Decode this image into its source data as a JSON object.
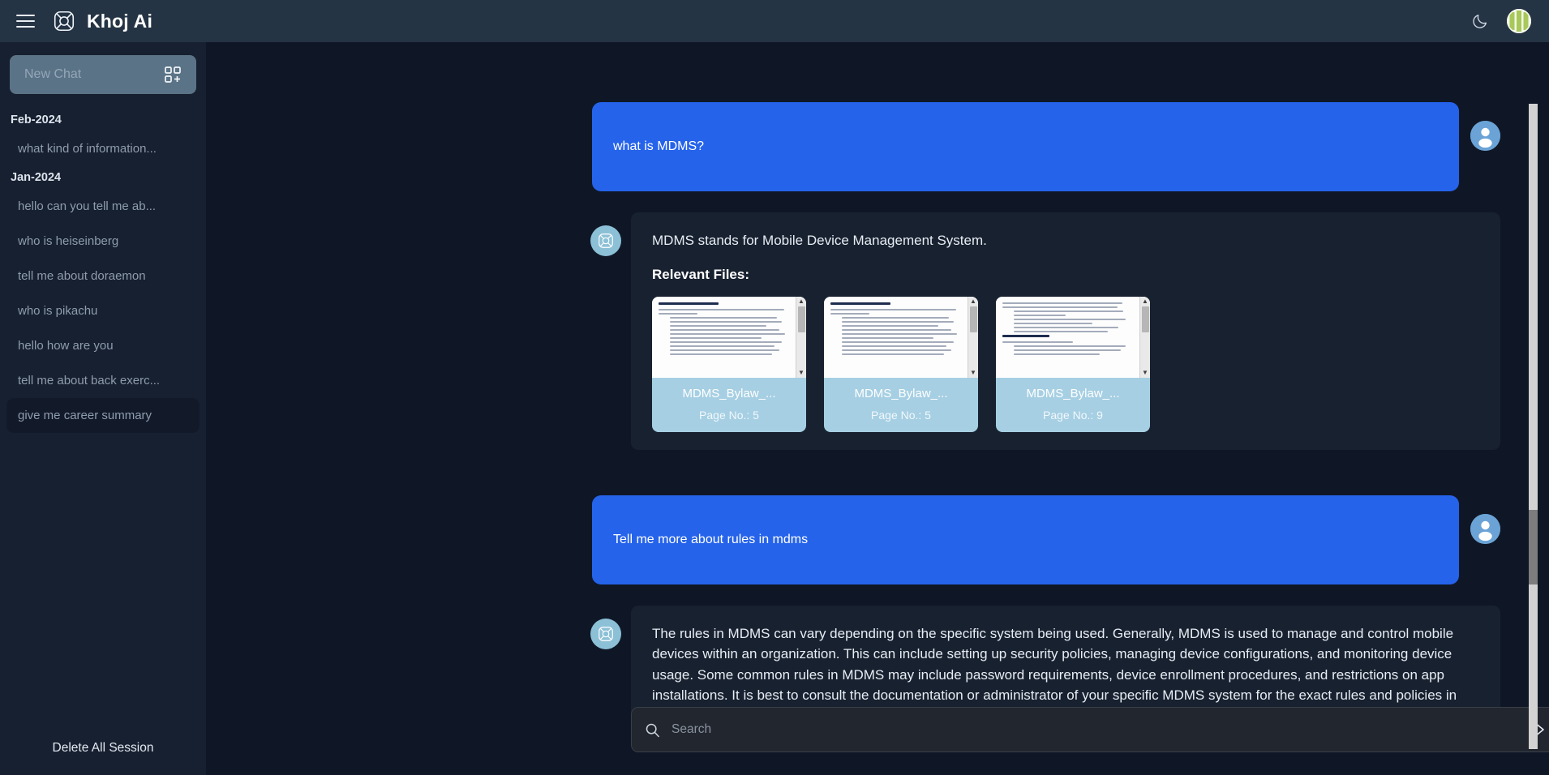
{
  "topbar": {
    "menu_icon": "hamburger-icon",
    "logo_icon": "khoj-logo-icon",
    "title": "Khoj Ai",
    "theme_icon": "moon-icon",
    "avatar_icon": "user-avatar"
  },
  "sidebar": {
    "new_chat_label": "New Chat",
    "new_chat_icon": "add-grid-icon",
    "groups": [
      {
        "label": "Feb-2024",
        "items": [
          {
            "label": "what kind of information...",
            "active": false
          }
        ]
      },
      {
        "label": "Jan-2024",
        "items": [
          {
            "label": "hello can you tell me ab...",
            "active": false
          },
          {
            "label": "who is heiseinberg",
            "active": false
          },
          {
            "label": "tell me about doraemon",
            "active": false
          },
          {
            "label": "who is pikachu",
            "active": false
          },
          {
            "label": "hello how are you",
            "active": false
          },
          {
            "label": "tell me about back exerc...",
            "active": false
          },
          {
            "label": "give me career summary",
            "active": true
          }
        ]
      }
    ],
    "delete_all_label": "Delete All Session"
  },
  "conversation": {
    "messages": [
      {
        "role": "user",
        "text": "what is MDMS?"
      },
      {
        "role": "assistant",
        "text": "MDMS stands for Mobile Device Management System.",
        "relevant_files_label": "Relevant Files:",
        "files": [
          {
            "name": "MDMS_Bylaw_...",
            "page": "Page No.: 5"
          },
          {
            "name": "MDMS_Bylaw_...",
            "page": "Page No.: 5"
          },
          {
            "name": "MDMS_Bylaw_...",
            "page": "Page No.: 9"
          }
        ]
      },
      {
        "role": "user",
        "text": "Tell me more about rules in mdms"
      },
      {
        "role": "assistant",
        "text": "The rules in MDMS can vary depending on the specific system being used. Generally, MDMS is used to manage and control mobile devices within an organization. This can include setting up security policies, managing device configurations, and monitoring device usage. Some common rules in MDMS may include password requirements, device enrollment procedures, and restrictions on app installations. It is best to consult the documentation or administrator of your specific MDMS system for the exact rules and policies in place."
      }
    ]
  },
  "search": {
    "placeholder": "Search",
    "value": "",
    "icon": "search-icon",
    "send_icon": "send-arrow-icon"
  },
  "colors": {
    "accent_blue": "#2563eb",
    "sidebar_bg": "#172030",
    "topbar_bg": "#253444",
    "main_bg": "#0f1726",
    "bot_bubble": "#18212f",
    "file_card": "#a6cfe3",
    "avatar_green": "#a8c85a"
  }
}
